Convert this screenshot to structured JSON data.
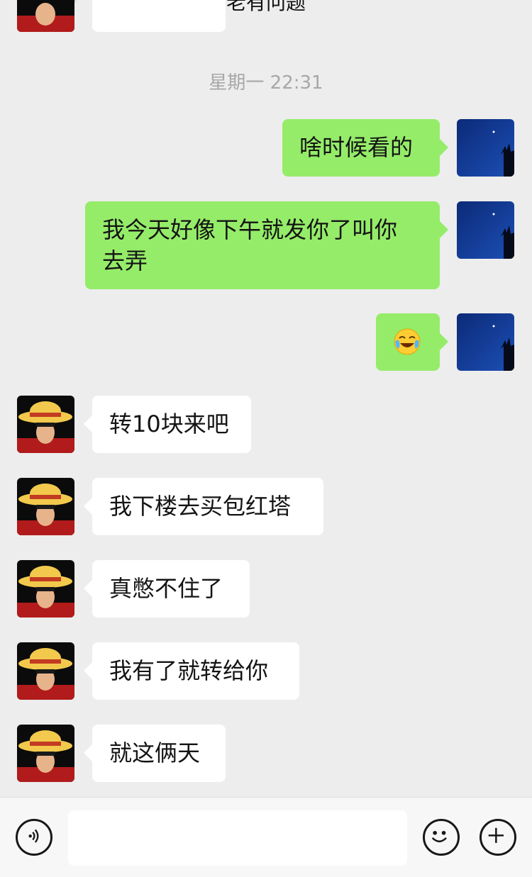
{
  "header": {
    "title": "老有问题"
  },
  "timestamp": "星期一 22:31",
  "messages": [
    {
      "sender": "me",
      "text": "啥时候看的"
    },
    {
      "sender": "me",
      "lines": [
        "我今天好像下午就发你了叫你",
        "去弄"
      ]
    },
    {
      "sender": "me",
      "emoji": "face-with-tears-of-joy"
    },
    {
      "sender": "other",
      "text": "转10块来吧"
    },
    {
      "sender": "other",
      "text": "我下楼去买包红塔"
    },
    {
      "sender": "other",
      "text": "真憋不住了"
    },
    {
      "sender": "other",
      "text": "我有了就转给你"
    },
    {
      "sender": "other",
      "text": "就这俩天"
    }
  ],
  "input_bar": {
    "voice_icon": "voice-icon",
    "emoji_icon": "smile-icon",
    "add_icon": "plus-icon",
    "placeholder": ""
  }
}
